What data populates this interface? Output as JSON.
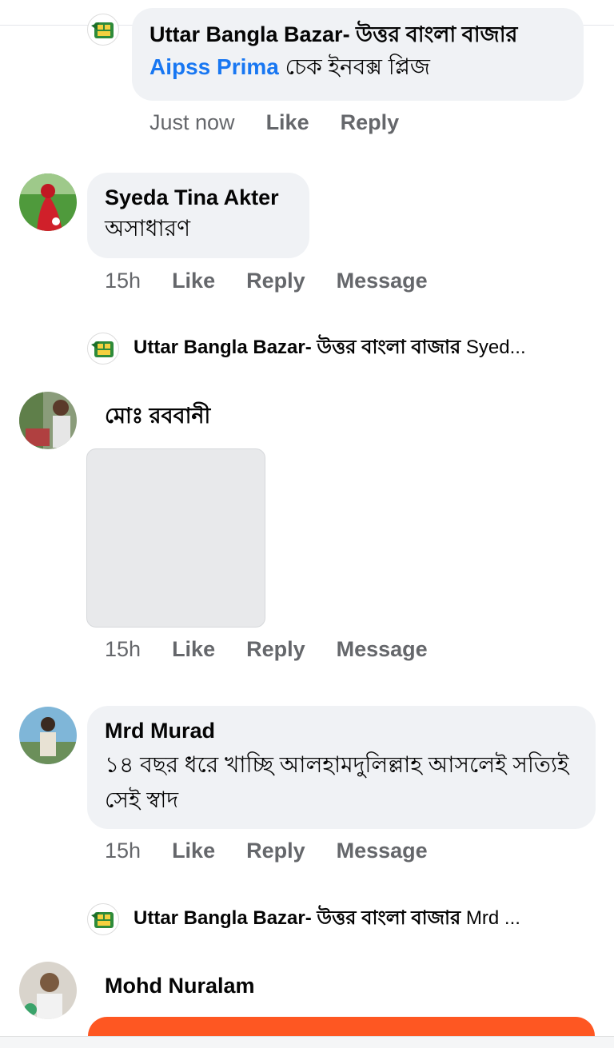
{
  "page_author": "Uttar Bangla Bazar- উত্তর বাংলা বাজার",
  "top_reply": {
    "author": "Uttar Bangla Bazar- উত্তর বাংলা বাজার",
    "mention": "Aipss Prima",
    "text": " চেক ইনবক্স প্লিজ",
    "time": "Just now",
    "like": "Like",
    "reply": "Reply"
  },
  "comments": [
    {
      "author": "Syeda Tina Akter",
      "text": "অসাধারণ",
      "time": "15h",
      "like": "Like",
      "reply": "Reply",
      "message": "Message",
      "reply_preview": {
        "author": "Uttar Bangla Bazar- উত্তর বাংলা বাজার",
        "snippet": " Syed..."
      }
    },
    {
      "author": "মোঃ রববানী",
      "time": "15h",
      "like": "Like",
      "reply": "Reply",
      "message": "Message"
    },
    {
      "author": "Mrd Murad",
      "text": "১৪ বছর ধরে খাচ্ছি আলহামদুলিল্লাহ আসলেই সত্যিই সেই স্বাদ",
      "time": "15h",
      "like": "Like",
      "reply": "Reply",
      "message": "Message",
      "reply_preview": {
        "author": "Uttar Bangla Bazar- উত্তর বাংলা বাজার",
        "snippet": " Mrd ..."
      }
    },
    {
      "author": "Mohd Nuralam"
    }
  ],
  "colors": {
    "link": "#1877f2",
    "meta": "#65676b",
    "bubble": "#f0f2f5",
    "accent": "#fe5722"
  }
}
